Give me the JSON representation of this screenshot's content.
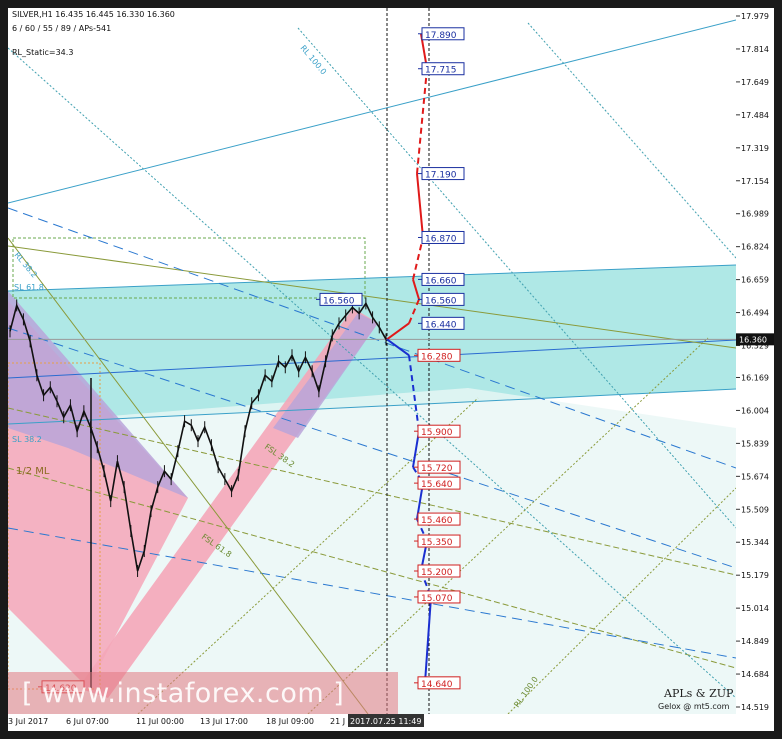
{
  "header": {
    "symbol_line": "SILVER,H1  16.435 16.445 16.330 16.360",
    "params_line": "6 / 60 / 55 / 89 / APs-541",
    "rl_static": "RL_Static=34.3"
  },
  "watermark": "[ www.instaforex.com ]",
  "brand": {
    "line1": "APLs & ZUP",
    "line2": "Gelox @ mt5.com"
  },
  "colors": {
    "background": "#ffffff",
    "band_cyan": "#a6e6e3",
    "band_pink": "#f4a6b8",
    "band_purple": "#b9a4d9",
    "up_projection": "#e01a1a",
    "down_projection": "#1a2fd0",
    "channel_blue": "#1e78c8",
    "label_blue_border": "#1a2fa0",
    "label_red_border": "#d02020",
    "price_line": "#111111"
  },
  "chart_data": {
    "type": "line",
    "title": "SILVER,H1",
    "current_price": 16.36,
    "ylim": [
      14.519,
      17.979
    ],
    "y_ticks": [
      17.979,
      17.814,
      17.649,
      17.484,
      17.319,
      17.154,
      16.989,
      16.824,
      16.659,
      16.494,
      16.329,
      16.169,
      16.004,
      15.839,
      15.674,
      15.509,
      15.344,
      15.179,
      15.014,
      14.849,
      14.684,
      14.519
    ],
    "x_ticks": [
      "3 Jul 2017",
      "6 Jul 07:00",
      "11 Jul 00:00",
      "13 Jul 17:00",
      "18 Jul 09:00",
      "21 J",
      "2017.07.25 11:49"
    ],
    "price_series": [
      [
        0,
        16.4
      ],
      [
        1,
        16.53
      ],
      [
        2,
        16.46
      ],
      [
        3,
        16.35
      ],
      [
        4,
        16.18
      ],
      [
        5,
        16.08
      ],
      [
        6,
        16.12
      ],
      [
        7,
        16.05
      ],
      [
        8,
        15.97
      ],
      [
        9,
        16.03
      ],
      [
        10,
        15.9
      ],
      [
        11,
        16.0
      ],
      [
        12,
        15.92
      ],
      [
        13,
        15.82
      ],
      [
        14,
        15.7
      ],
      [
        15,
        15.55
      ],
      [
        16,
        15.75
      ],
      [
        17,
        15.62
      ],
      [
        18,
        15.4
      ],
      [
        19,
        15.2
      ],
      [
        20,
        15.3
      ],
      [
        21,
        15.5
      ],
      [
        22,
        15.62
      ],
      [
        23,
        15.7
      ],
      [
        24,
        15.66
      ],
      [
        25,
        15.8
      ],
      [
        26,
        15.95
      ],
      [
        27,
        15.93
      ],
      [
        28,
        15.85
      ],
      [
        29,
        15.92
      ],
      [
        30,
        15.83
      ],
      [
        31,
        15.72
      ],
      [
        32,
        15.66
      ],
      [
        33,
        15.6
      ],
      [
        34,
        15.68
      ],
      [
        35,
        15.9
      ],
      [
        36,
        16.04
      ],
      [
        37,
        16.08
      ],
      [
        38,
        16.18
      ],
      [
        39,
        16.15
      ],
      [
        40,
        16.25
      ],
      [
        41,
        16.22
      ],
      [
        42,
        16.28
      ],
      [
        43,
        16.2
      ],
      [
        44,
        16.27
      ],
      [
        45,
        16.2
      ],
      [
        46,
        16.1
      ],
      [
        47,
        16.25
      ],
      [
        48,
        16.38
      ],
      [
        49,
        16.44
      ],
      [
        50,
        16.48
      ],
      [
        51,
        16.52
      ],
      [
        52,
        16.49
      ],
      [
        53,
        16.54
      ],
      [
        54,
        16.47
      ],
      [
        55,
        16.42
      ],
      [
        56,
        16.36
      ]
    ],
    "projections_up": [
      17.89,
      17.715,
      17.19,
      16.87,
      16.66,
      16.56,
      16.44
    ],
    "projections_down": [
      16.28,
      15.9,
      15.72,
      15.64,
      15.46,
      15.35,
      15.2,
      15.07,
      14.64
    ],
    "marker_labels": [
      "16.560",
      "14.620"
    ],
    "annotations": [
      "RL 100.0",
      "RL 38.2",
      "SL 61.8",
      "SL 38.2",
      "1/2 ML",
      "FSL 38.2",
      "FSL 61.8",
      "RL 100.0"
    ],
    "grid": false
  }
}
